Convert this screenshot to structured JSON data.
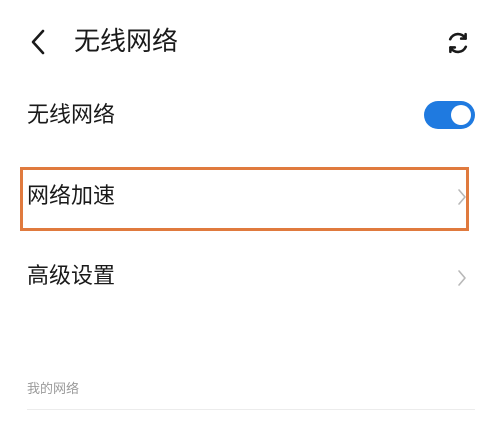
{
  "header": {
    "title": "无线网络",
    "back_icon": "chevron-left-icon",
    "refresh_icon": "refresh-icon"
  },
  "settings": {
    "wifi_label": "无线网络",
    "wifi_enabled": true,
    "network_speedup_label": "网络加速",
    "advanced_settings_label": "高级设置"
  },
  "my_networks": {
    "section_label": "我的网络"
  },
  "colors": {
    "accent": "#1f7ae0",
    "highlight": "#e07a3e",
    "section_text": "#9a9a9a"
  }
}
